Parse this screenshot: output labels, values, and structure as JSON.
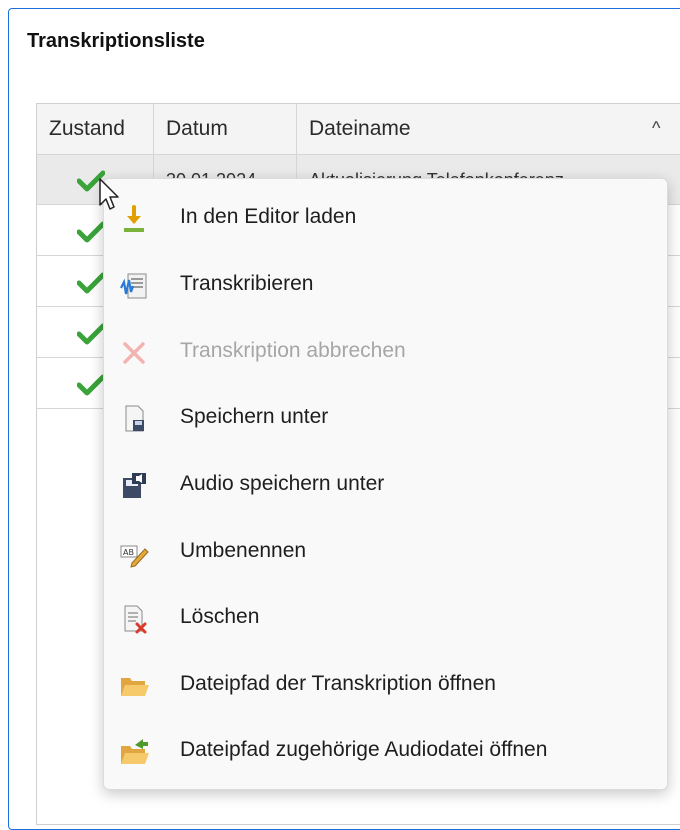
{
  "panel": {
    "title": "Transkriptionsliste"
  },
  "table": {
    "columns": [
      "Zustand",
      "Datum",
      "Dateiname"
    ],
    "sort_indicator": "^",
    "rows": [
      {
        "status": "check-icon",
        "date": "30.01.2024",
        "filename": "Aktualisierung Telefonkonferenz"
      },
      {
        "status": "check-icon",
        "date": "",
        "filename": ""
      },
      {
        "status": "check-icon",
        "date": "",
        "filename": ""
      },
      {
        "status": "check-icon",
        "date": "",
        "filename": ""
      },
      {
        "status": "check-icon",
        "date": "",
        "filename": ""
      }
    ]
  },
  "context_menu": {
    "items": [
      {
        "label": "In den Editor laden",
        "icon": "download-arrow-icon",
        "enabled": true
      },
      {
        "label": "Transkribieren",
        "icon": "transcribe-icon",
        "enabled": true
      },
      {
        "label": "Transkription abbrechen",
        "icon": "cancel-x-icon",
        "enabled": false
      },
      {
        "label": "Speichern unter",
        "icon": "save-document-icon",
        "enabled": true
      },
      {
        "label": "Audio speichern unter",
        "icon": "save-audio-icon",
        "enabled": true
      },
      {
        "label": "Umbenennen",
        "icon": "rename-icon",
        "enabled": true
      },
      {
        "label": "Löschen",
        "icon": "delete-document-icon",
        "enabled": true
      },
      {
        "label": "Dateipfad der Transkription öffnen",
        "icon": "folder-open-icon",
        "enabled": true
      },
      {
        "label": "Dateipfad zugehörige Audiodatei öffnen",
        "icon": "folder-open-arrow-icon",
        "enabled": true
      }
    ]
  },
  "colors": {
    "accent_border": "#1e6fd9",
    "check_green": "#3aa33a",
    "disabled_text": "#a6a6a6"
  }
}
